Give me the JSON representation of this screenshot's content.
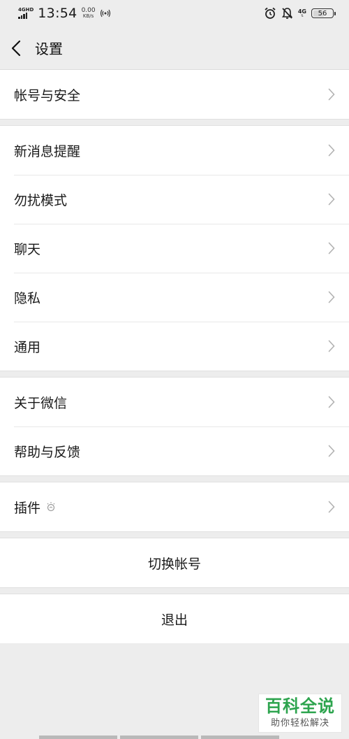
{
  "status_bar": {
    "network_type": "4GHD",
    "time": "13:54",
    "speed_value": "0.00",
    "speed_unit": "KB/s",
    "network_right": "4G",
    "battery": "56",
    "battery_level": 56
  },
  "nav": {
    "title": "设置"
  },
  "groups": {
    "account": {
      "items": [
        "帐号与安全"
      ]
    },
    "general": {
      "items": [
        "新消息提醒",
        "勿扰模式",
        "聊天",
        "隐私",
        "通用"
      ]
    },
    "about": {
      "items": [
        "关于微信",
        "帮助与反馈"
      ]
    },
    "plugins": {
      "items": [
        "插件"
      ]
    }
  },
  "actions": {
    "switch_account": "切换帐号",
    "logout": "退出"
  },
  "watermark": {
    "title": "百科全说",
    "subtitle": "助你轻松解决"
  },
  "colors": {
    "background": "#ededed",
    "card": "#ffffff",
    "watermark_green": "#2da44e"
  }
}
